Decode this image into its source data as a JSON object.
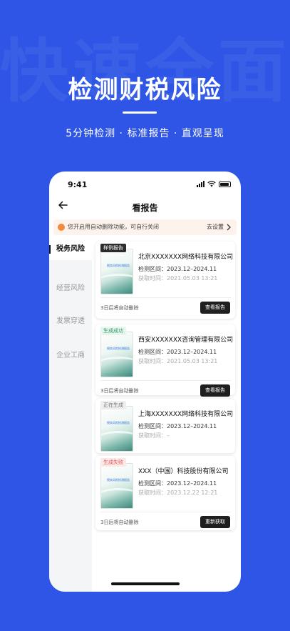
{
  "hero": {
    "watermark": "快速全面",
    "title": "检测财税风险",
    "subtitle": "5分钟检测 · 标准报告 · 直观呈现"
  },
  "status_bar": {
    "time": "9:41"
  },
  "nav": {
    "title": "看报告"
  },
  "notice": {
    "text": "您开启用自动删除功能，可自行关闭",
    "action": "去设置"
  },
  "sidebar": {
    "items": [
      {
        "label": "税务风险",
        "active": true
      },
      {
        "label": "经营风险",
        "active": false
      },
      {
        "label": "发票穿透",
        "active": false
      },
      {
        "label": "企业工商",
        "active": false
      }
    ]
  },
  "reports": [
    {
      "badge": "样例报告",
      "badge_type": "sample",
      "thumb_caption": "税务风险检测报告",
      "company": "北京XXXXXXX网络科技有限公司",
      "range": "检测区间：2023.12–2024.11",
      "fetched": "获取时间：2021.05.03 13:21",
      "auto_delete": "3日后将自动删除",
      "button": "查看报告"
    },
    {
      "badge": "生成成功",
      "badge_type": "success",
      "thumb_caption": "税务风险检测报告",
      "company": "西安XXXXXXX咨询管理有限公司",
      "range": "检测区间：2023.12–2024.11",
      "fetched": "获取时间：2021.05.03 13:21",
      "auto_delete": "3日后将自动删除",
      "button": "查看报告"
    },
    {
      "badge": "正在生成",
      "badge_type": "generating",
      "thumb_caption": "税务风险检测报告",
      "company": "上海XXXXXXX网络科技有限公司",
      "range": "检测区间：2023.12–2024.11",
      "fetched": "获取时间：–",
      "auto_delete": "",
      "button": ""
    },
    {
      "badge": "生成失败",
      "badge_type": "failed",
      "thumb_caption": "税务风险检测报告",
      "company": "XXX（中国）科技股份有限公司",
      "range": "检测区间：2023.12–2024.11",
      "fetched": "获取时间：2023.12.22 12:21",
      "auto_delete": "3日后将自动删除",
      "button": "重新获取"
    }
  ]
}
